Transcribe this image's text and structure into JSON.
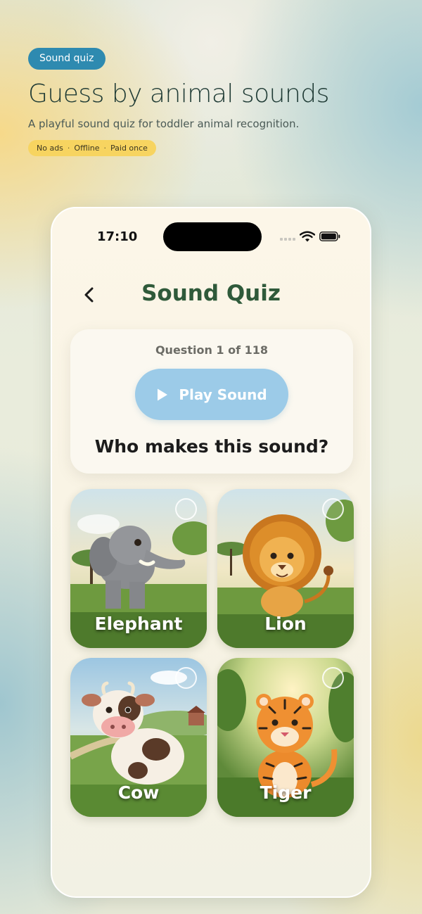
{
  "promo": {
    "tag": "Sound quiz",
    "headline": "Guess by animal sounds",
    "subhead": "A playful sound quiz for toddler animal recognition.",
    "features": [
      "No ads",
      "Offline",
      "Paid once"
    ],
    "separator": "·"
  },
  "status_bar": {
    "time": "17:10"
  },
  "screen": {
    "title": "Sound Quiz",
    "question_counter": "Question 1 of 118",
    "play_label": "Play Sound",
    "prompt": "Who makes this sound?"
  },
  "options": [
    {
      "label": "Elephant",
      "icon": "elephant-illustration",
      "selected": false
    },
    {
      "label": "Lion",
      "icon": "lion-illustration",
      "selected": false
    },
    {
      "label": "Cow",
      "icon": "cow-illustration",
      "selected": false
    },
    {
      "label": "Tiger",
      "icon": "tiger-illustration",
      "selected": false
    }
  ],
  "colors": {
    "tag": "#2e8ab0",
    "feature_pill": "#f7d460",
    "title": "#2f5a3a",
    "play_button": "#9ccbe8"
  }
}
